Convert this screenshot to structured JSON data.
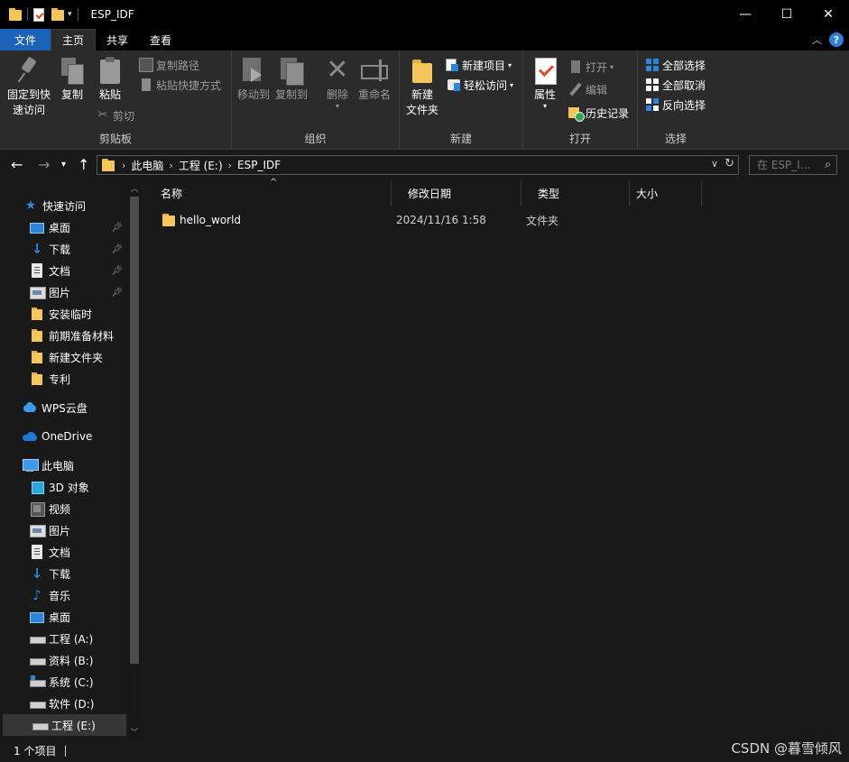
{
  "window": {
    "title": "ESP_IDF",
    "controls": {
      "minimize": "—",
      "maximize": "☐",
      "close": "✕"
    }
  },
  "ribbon_tabs": [
    {
      "label": "文件"
    },
    {
      "label": "主页"
    },
    {
      "label": "共享"
    },
    {
      "label": "查看"
    }
  ],
  "ribbon": {
    "clipboard": {
      "group_label": "剪贴板",
      "pin_quick_access": "固定到快\n速访问",
      "pin_line1": "固定到快",
      "pin_line2": "速访问",
      "copy": "复制",
      "paste": "粘贴",
      "copy_path": "复制路径",
      "paste_shortcut": "粘贴快捷方式",
      "cut": "剪切"
    },
    "organize": {
      "group_label": "组织",
      "move_to": "移动到",
      "copy_to": "复制到",
      "delete": "删除",
      "rename": "重命名"
    },
    "new": {
      "group_label": "新建",
      "new_folder_line1": "新建",
      "new_folder_line2": "文件夹",
      "new_item": "新建项目",
      "easy_access": "轻松访问"
    },
    "open": {
      "group_label": "打开",
      "properties": "属性",
      "open": "打开",
      "edit": "编辑",
      "history": "历史记录"
    },
    "select": {
      "group_label": "选择",
      "select_all": "全部选择",
      "select_none": "全部取消",
      "invert_selection": "反向选择"
    }
  },
  "address": {
    "breadcrumb": [
      "此电脑",
      "工程 (E:)",
      "ESP_IDF"
    ],
    "search_placeholder": "在 ESP_I..."
  },
  "sidebar": {
    "quick_access": "快速访问",
    "quick_items": [
      {
        "label": "桌面",
        "icon": "desktop-icon",
        "pinned": true
      },
      {
        "label": "下载",
        "icon": "download-icon",
        "pinned": true
      },
      {
        "label": "文档",
        "icon": "document-icon",
        "pinned": true
      },
      {
        "label": "图片",
        "icon": "picture-icon",
        "pinned": true
      },
      {
        "label": "安装临时",
        "icon": "folder-icon",
        "pinned": false
      },
      {
        "label": "前期准备材料",
        "icon": "folder-icon",
        "pinned": false
      },
      {
        "label": "新建文件夹",
        "icon": "folder-icon",
        "pinned": false
      },
      {
        "label": "专利",
        "icon": "folder-icon",
        "pinned": false
      }
    ],
    "wps_cloud": "WPS云盘",
    "onedrive": "OneDrive",
    "this_pc": "此电脑",
    "pc_items": [
      {
        "label": "3D 对象",
        "icon": "3d-objects-icon"
      },
      {
        "label": "视频",
        "icon": "video-icon"
      },
      {
        "label": "图片",
        "icon": "picture-icon"
      },
      {
        "label": "文档",
        "icon": "document-icon"
      },
      {
        "label": "下载",
        "icon": "download-icon"
      },
      {
        "label": "音乐",
        "icon": "music-icon"
      },
      {
        "label": "桌面",
        "icon": "desktop-icon"
      },
      {
        "label": "工程 (A:)",
        "icon": "drive-icon"
      },
      {
        "label": "资料 (B:)",
        "icon": "drive-icon"
      },
      {
        "label": "系统 (C:)",
        "icon": "system-drive-icon"
      },
      {
        "label": "软件 (D:)",
        "icon": "drive-icon"
      },
      {
        "label": "工程 (E:)",
        "icon": "drive-icon",
        "selected": true
      }
    ]
  },
  "file_list": {
    "columns": [
      "名称",
      "修改日期",
      "类型",
      "大小"
    ],
    "rows": [
      {
        "name": "hello_world",
        "modified": "2024/11/16 1:58",
        "type": "文件夹",
        "size": ""
      }
    ]
  },
  "status": {
    "item_count": "1 个项目"
  },
  "watermark": "CSDN @暮雪倾风",
  "colors": {
    "accent": "#1a63b8",
    "background": "#191919",
    "ribbon": "#2b2b2b",
    "folder": "#f5c75a"
  }
}
